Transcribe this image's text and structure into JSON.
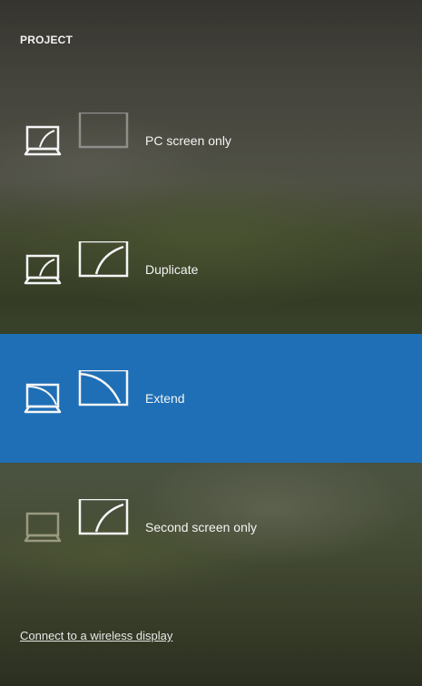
{
  "panel": {
    "title": "PROJECT"
  },
  "options": [
    {
      "label": "PC screen only",
      "icon": "pc-screen-only-icon",
      "selected": false
    },
    {
      "label": "Duplicate",
      "icon": "duplicate-icon",
      "selected": false
    },
    {
      "label": "Extend",
      "icon": "extend-icon",
      "selected": true
    },
    {
      "label": "Second screen only",
      "icon": "second-screen-only-icon",
      "selected": false
    }
  ],
  "footer": {
    "link_label": "Connect to a wireless display"
  },
  "colors": {
    "selected_background": "#1e6fb6",
    "text": "#f4f4f4"
  }
}
